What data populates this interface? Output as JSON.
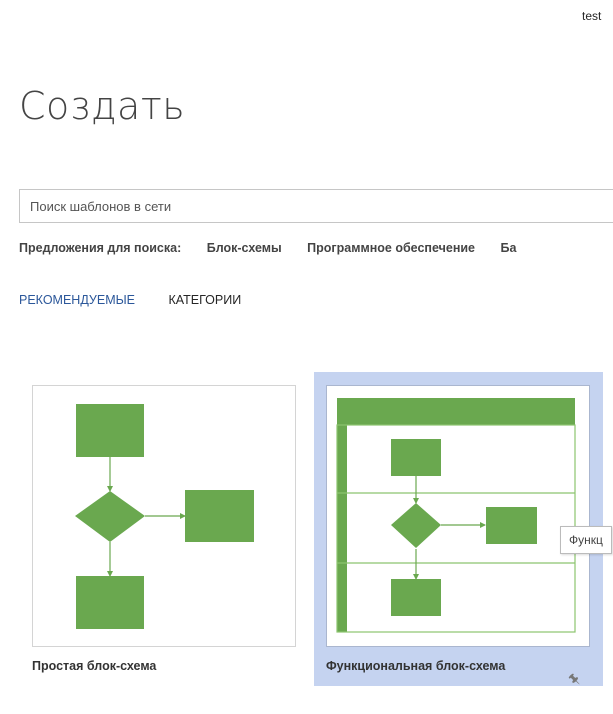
{
  "header": {
    "user_name": "test"
  },
  "page": {
    "title": "Создать"
  },
  "search": {
    "placeholder": "Поиск шаблонов в сети"
  },
  "suggestions": {
    "label": "Предложения для поиска:",
    "items": [
      "Блок-схемы",
      "Программное обеспечение",
      "Ба"
    ]
  },
  "tabs": [
    {
      "label": "РЕКОМЕНДУЕМЫЕ",
      "active": true
    },
    {
      "label": "КАТЕГОРИИ",
      "active": false
    }
  ],
  "templates": [
    {
      "title": "Простая блок-схема",
      "selected": false
    },
    {
      "title": "Функциональная блок-схема",
      "selected": true
    }
  ],
  "tooltip": {
    "text": "Функц"
  },
  "colors": {
    "shape_fill": "#6aa84f",
    "selection_bg": "#c5d3f0",
    "accent_tab": "#2b579a"
  },
  "icons": {
    "pin": "pin-icon"
  }
}
